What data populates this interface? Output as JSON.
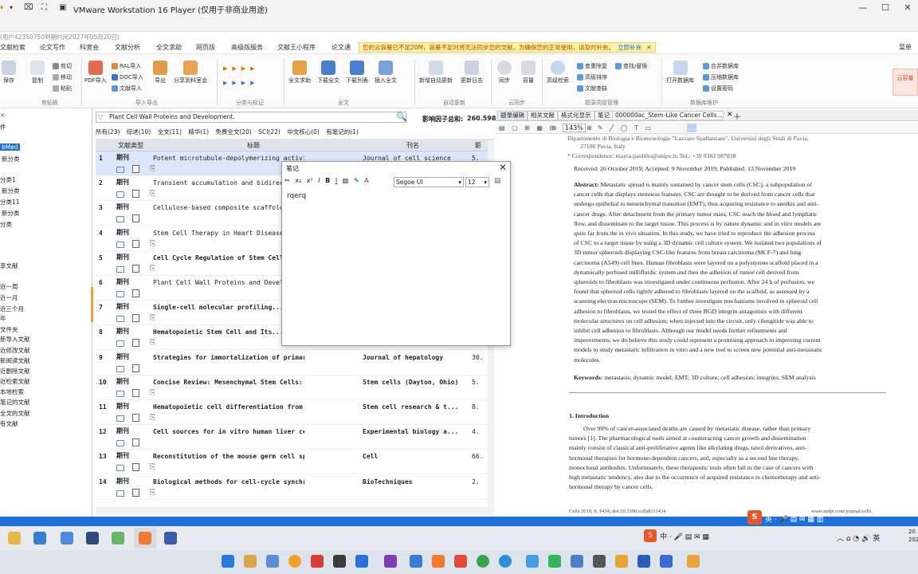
{
  "window": {
    "title": "VMware Workstation 16 Player (仅用于非商业用途)",
    "account_notice": "(用户42350750到期时间2027年05月20日)"
  },
  "menu": {
    "items": [
      "文献检索",
      "论文写作",
      "科室会",
      "文献分析",
      "全文求助",
      "网页版",
      "高级版服务",
      "文献王小程序",
      "论文通"
    ],
    "alert_text": "您的云容量已不足20M，容量不足时将无法同步您的文献，为确保您的正常使用，请及时补充。",
    "alert_link": "立即补充",
    "right_label": "菜单"
  },
  "ribbon": {
    "buttons": [
      "保存",
      "复制",
      "PDF导入",
      "导出",
      "分享到科室会",
      "全文求助",
      "下载全文",
      "下载列表",
      "插入全文",
      "新增自动更新",
      "更新日志",
      "同步",
      "容量",
      "高级检索",
      "打开数据库"
    ],
    "small_items": [
      "剪切",
      "移动",
      "粘贴",
      "RAL导入",
      "DOC导入",
      "文献导入",
      "查重除复",
      "查找/替换",
      "高级排序",
      "文献查缺",
      "合并数据库",
      "压缩数据库",
      "设置密码"
    ],
    "groups": [
      "剪贴板",
      "导入导出",
      "分类与标记",
      "全文",
      "自动更新",
      "云同步",
      "题录高级管理",
      "数据库维护"
    ],
    "corner_badge": "云容量"
  },
  "sidebar": {
    "items": [
      "件",
      "bMed",
      "新分类",
      "分类1",
      "新分类",
      "分类11",
      "新分类",
      "分类",
      "享文献",
      "近一周",
      "近一月",
      "近三个月",
      "年",
      "文件夹",
      "新导入文献",
      "近修改文献",
      "新阅读文献",
      "近删除文献",
      "近检索文献",
      "本地检索",
      "笔记的文献",
      "全文的文献",
      "有文献"
    ]
  },
  "search": {
    "value": "Plant Cell Wall Proteins and Development.",
    "impact_label": "影响因子总和:",
    "impact_value": "260.598"
  },
  "filters": [
    "所有(23)",
    "综述(10)",
    "全文(11)",
    "精华(1)",
    "免费全文(20)",
    "SCI(22)",
    "中文核心(0)",
    "有笔记的(1)"
  ],
  "list": {
    "headers": {
      "type": "文献类型",
      "title": "标题",
      "journal": "刊名",
      "if": "影"
    },
    "rows": [
      {
        "num": "1",
        "type": "期刊",
        "title": "Potent microtubule-depolymerizing activity of a mito...",
        "journal": "Journal of cell science",
        "if": "5.",
        "bold": false
      },
      {
        "num": "2",
        "type": "期刊",
        "title": "Transient accumulation and bidirectional movement...",
        "journal": "",
        "if": "",
        "bold": false
      },
      {
        "num": "3",
        "type": "期刊",
        "title": "Cellulose-based composite scaffolds...",
        "journal": "",
        "if": "",
        "bold": false
      },
      {
        "num": "4",
        "type": "期刊",
        "title": "Stem Cell Therapy in Heart Diseases...",
        "journal": "",
        "if": "",
        "bold": false
      },
      {
        "num": "5",
        "type": "期刊",
        "title": "Cell Cycle Regulation of Stem Cells...",
        "journal": "",
        "if": "",
        "bold": true
      },
      {
        "num": "6",
        "type": "期刊",
        "title": "Plant Cell Wall Proteins and Development.",
        "journal": "",
        "if": "",
        "bold": false
      },
      {
        "num": "7",
        "type": "期刊",
        "title": "Single-cell molecular profiling...",
        "journal": "",
        "if": "",
        "bold": true
      },
      {
        "num": "8",
        "type": "期刊",
        "title": "Hematopoietic Stem Cell and Its...",
        "journal": "",
        "if": "",
        "bold": true
      },
      {
        "num": "9",
        "type": "期刊",
        "title": "Strategies for immortalization of primary hep...",
        "journal": "Journal of hepatology",
        "if": "30.",
        "bold": true
      },
      {
        "num": "10",
        "type": "期刊",
        "title": "Concise Review: Mesenchymal Stem Cells: From ...",
        "journal": "Stem cells (Dayton, Ohio)",
        "if": "5.",
        "bold": true
      },
      {
        "num": "11",
        "type": "期刊",
        "title": "Hematopoietic cell differentiation from embry...",
        "journal": "Stem cell research & t...",
        "if": "8.",
        "bold": true
      },
      {
        "num": "12",
        "type": "期刊",
        "title": "Cell sources for in  vitro human liver cell cu...",
        "journal": "Experimental biology a...",
        "if": "4.",
        "bold": true
      },
      {
        "num": "13",
        "type": "期刊",
        "title": "Reconstitution of the mouse germ cell specifi...",
        "journal": "Cell",
        "if": "66.",
        "bold": true
      },
      {
        "num": "14",
        "type": "期刊",
        "title": "Biological methods for cell-cycle synchroniza...",
        "journal": "BioTechniques",
        "if": "2.",
        "bold": true
      }
    ]
  },
  "note_dialog": {
    "title": "笔记",
    "font": "Segoe UI",
    "size": "12",
    "content": "rqerq"
  },
  "doc_tabs": [
    "题录编辑",
    "相关文献",
    "格式化显示",
    "笔记",
    "000000ac_Stem-Like Cancer Cells ..."
  ],
  "viewer": {
    "zoom": "143%"
  },
  "paper": {
    "affil_1": "Dipartimento di Biologia e Biotecnologie \"Lazzaro Spallanzani\", Università degli Studi di Pavia,",
    "affil_2": "27100 Pavia, Italy",
    "correspondence": "Correspondence: mayra.paolillo@unipv.it; Tel.: +39 0382 987838",
    "received": "Received: 26 October 2019; Accepted: 9 November 2019; Published: 13 November 2019",
    "abstract_label": "Abstract:",
    "abstract_lines": [
      "Metastatic spread is mainly sustained by cancer stem cells (CSC), a subpopulation of",
      "cancer cells that displays stemness features. CSC are thought to be derived from cancer cells that",
      "undergo epithelial to mesenchymal transition (EMT), thus acquiring resistance to anoikis and anti-",
      "cancer drugs. After detachment from the primary tumor mass, CSC reach the blood and lymphatic",
      "flow, and disseminate to the target tissue. This process is by nature dynamic and in vitro models are",
      "quite far from the in vivo situation. In this study, we have tried to reproduce the adhesion process",
      "of CSC to a target tissue by using a 3D dynamic cell culture system. We isolated two populations of",
      "3D tumor spheroids displaying CSC-like features from breast carcinoma (MCF-7) and lung",
      "carcinoma (A549) cell lines. Human fibroblasts were layered on a polystyrene scaffold placed in a",
      "dynamically perfused millifluidic system and then the adhesion of tumor cell derived from",
      "spheroids to fibroblasts was investigated under continuous perfusion. After 24 h of perfusion, we",
      "found that spheroid cells tightly adhered to fibroblasts layered on the scaffold, as assessed by a",
      "scanning electron microscope (SEM). To further investigate mechanisms involved in spheroid cell",
      "adhesion to fibroblasts, we tested the effect of three RGD integrin antagonists with different",
      "molecular structures on cell adhesion; when injected into the circuit, only cilengitide was able to",
      "inhibit cell adhesion to fibroblasts. Although our model needs further refinements and",
      "improvements, we do believe this study could represent a promising approach in improving current",
      "models to study metastatic infiltration in vitro and a new tool to screen new potential anti-metastatic",
      "molecules."
    ],
    "keywords_label": "Keywords:",
    "keywords": "metastasis; dynamic model; EMT; 3D culture; cell adhesion; integrins; SEM analysis",
    "section_title": "1. Introduction",
    "intro_lines": [
      "Over 90% of cancer-associated deaths are caused by metastatic disease, rather than primary",
      "tumors [1]. The pharmacological tools aimed at counteracting cancer growth and dissemination",
      "mainly consist of classical anti-proliferative agents like alkylating drugs, taxol derivatives, anti-",
      "hormonal therapies for hormone-dependent cancers, and, especially as a second line therapy,",
      "monoclonal antibodies. Unfortunately, these therapeutic tools often fail in the case of cancers with",
      "high metastatic tendency, also due to the occurrence of acquired resistance to chemotherapy and anti-",
      "hormonal therapy by cancer cells."
    ],
    "footer_left": "Cells 2019, 8, 1434; doi:10.3390/cells8111434",
    "footer_right": "www.mdpi.com/journal/cells"
  },
  "vm_tray": {
    "ime": "英"
  },
  "host_tray": {
    "ime": "中",
    "lang": "英",
    "time": "20",
    "date": "202"
  }
}
